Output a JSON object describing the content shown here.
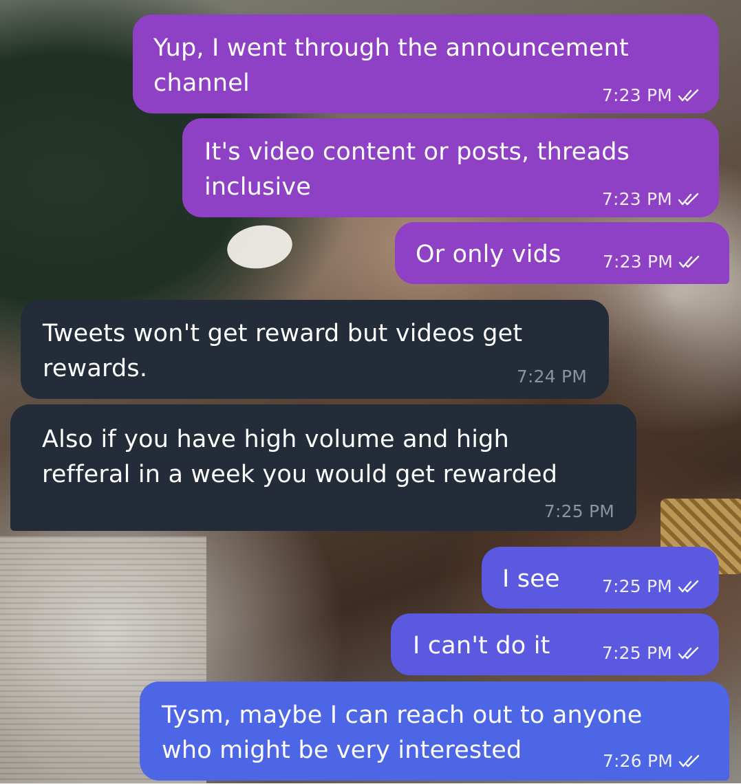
{
  "colors": {
    "outgoing_purple": "#8e41c4",
    "outgoing_indigo": "#5a59e0",
    "outgoing_blue": "#4d66e6",
    "incoming_dark": "#232c38",
    "incoming_meta": "#8b939c"
  },
  "messages": [
    {
      "direction": "outgoing",
      "text": "Yup, I went through the announcement\nchannel",
      "time": "7:23 PM",
      "status_icon": "double-check-icon"
    },
    {
      "direction": "outgoing",
      "text": "It's video content or posts, threads\ninclusive",
      "time": "7:23 PM",
      "status_icon": "double-check-icon"
    },
    {
      "direction": "outgoing",
      "text": "Or only vids",
      "time": "7:23 PM",
      "status_icon": "double-check-icon"
    },
    {
      "direction": "incoming",
      "text": "Tweets won't get reward but videos get\nrewards.",
      "time": "7:24 PM"
    },
    {
      "direction": "incoming",
      "text": "Also if you have high volume and high\nrefferal in a week you would get rewarded",
      "time": "7:25 PM"
    },
    {
      "direction": "outgoing",
      "text": "I see",
      "time": "7:25 PM",
      "status_icon": "double-check-icon"
    },
    {
      "direction": "outgoing",
      "text": "I can't do it",
      "time": "7:25 PM",
      "status_icon": "double-check-icon"
    },
    {
      "direction": "outgoing",
      "text": "Tysm, maybe I can reach out to anyone\nwho might be very interested",
      "time": "7:26 PM",
      "status_icon": "double-check-icon"
    }
  ]
}
